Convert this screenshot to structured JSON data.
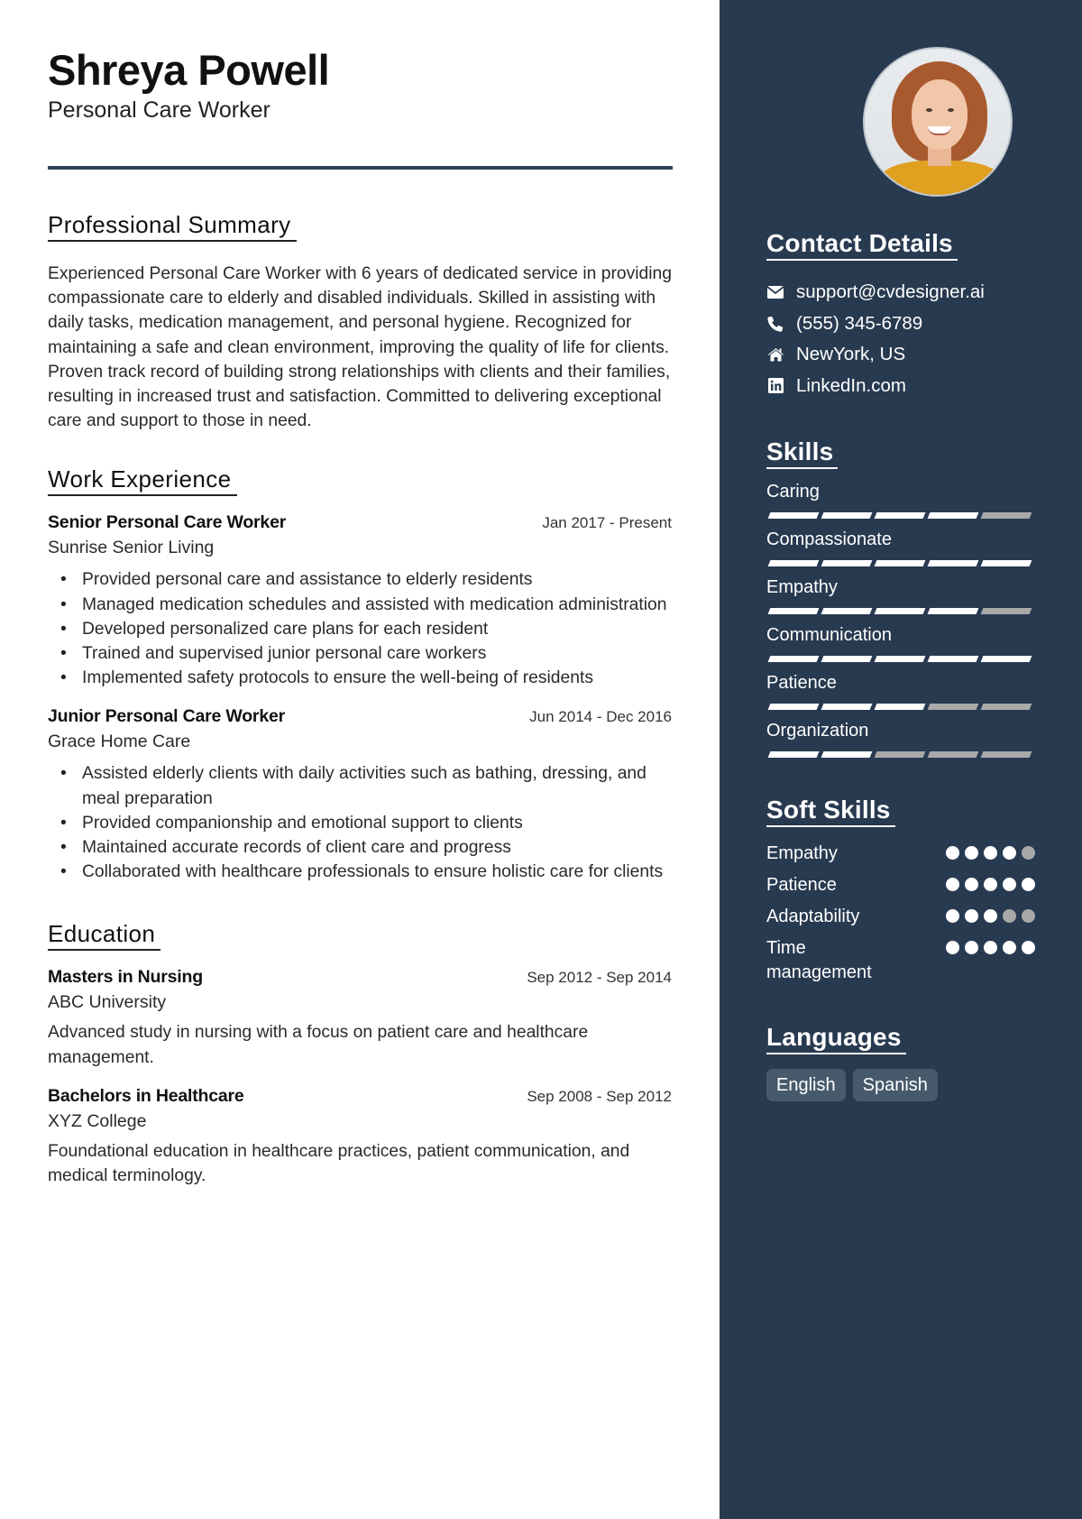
{
  "header": {
    "name": "Shreya Powell",
    "title": "Personal Care Worker"
  },
  "summary": {
    "heading": "Professional Summary",
    "text": "Experienced Personal Care Worker with 6 years of dedicated service in providing compassionate care to elderly and disabled individuals. Skilled in assisting with daily tasks, medication management, and personal hygiene. Recognized for maintaining a safe and clean environment, improving the quality of life for clients. Proven track record of building strong relationships with clients and their families, resulting in increased trust and satisfaction. Committed to delivering exceptional care and support to those in need."
  },
  "work": {
    "heading": "Work Experience",
    "jobs": [
      {
        "title": "Senior Personal Care Worker",
        "date": "Jan 2017 - Present",
        "org": "Sunrise Senior Living",
        "bullets": [
          "Provided personal care and assistance to elderly residents",
          "Managed medication schedules and assisted with medication administration",
          "Developed personalized care plans for each resident",
          "Trained and supervised junior personal care workers",
          "Implemented safety protocols to ensure the well-being of residents"
        ]
      },
      {
        "title": "Junior Personal Care Worker",
        "date": "Jun 2014 - Dec 2016",
        "org": "Grace Home Care",
        "bullets": [
          "Assisted elderly clients with daily activities such as bathing, dressing, and meal preparation",
          "Provided companionship and emotional support to clients",
          "Maintained accurate records of client care and progress",
          "Collaborated with healthcare professionals to ensure holistic care for clients"
        ]
      }
    ]
  },
  "education": {
    "heading": "Education",
    "items": [
      {
        "degree": "Masters in Nursing",
        "date": "Sep 2012 - Sep 2014",
        "school": "ABC University",
        "desc": "Advanced study in nursing with a focus on patient care and healthcare management."
      },
      {
        "degree": "Bachelors in Healthcare",
        "date": "Sep 2008 - Sep 2012",
        "school": "XYZ College",
        "desc": "Foundational education in healthcare practices, patient communication, and medical terminology."
      }
    ]
  },
  "sidebar": {
    "photo_alt": "Profile photo",
    "contact": {
      "heading": "Contact Details",
      "items": [
        {
          "icon": "envelope-icon",
          "text": "support@cvdesigner.ai"
        },
        {
          "icon": "phone-icon",
          "text": "(555) 345-6789"
        },
        {
          "icon": "home-icon",
          "text": "NewYork, US"
        },
        {
          "icon": "linkedin-icon",
          "text": "LinkedIn.com"
        }
      ]
    },
    "skills": {
      "heading": "Skills",
      "max": 5,
      "items": [
        {
          "name": "Caring",
          "level": 4
        },
        {
          "name": "Compassionate",
          "level": 5
        },
        {
          "name": "Empathy",
          "level": 4
        },
        {
          "name": "Communication",
          "level": 5
        },
        {
          "name": "Patience",
          "level": 3
        },
        {
          "name": "Organization",
          "level": 2
        }
      ]
    },
    "soft_skills": {
      "heading": "Soft Skills",
      "max": 5,
      "items": [
        {
          "name": "Empathy",
          "level": 4
        },
        {
          "name": "Patience",
          "level": 5
        },
        {
          "name": "Adaptability",
          "level": 3
        },
        {
          "name": "Time management",
          "level": 5
        }
      ]
    },
    "languages": {
      "heading": "Languages",
      "items": [
        "English",
        "Spanish"
      ]
    }
  },
  "colors": {
    "sidebar_bg": "#283a50",
    "divider": "#2e4257",
    "rating_on": "#ffffff",
    "rating_off": "#a9a9aa",
    "language_chip": "#475a6c"
  }
}
